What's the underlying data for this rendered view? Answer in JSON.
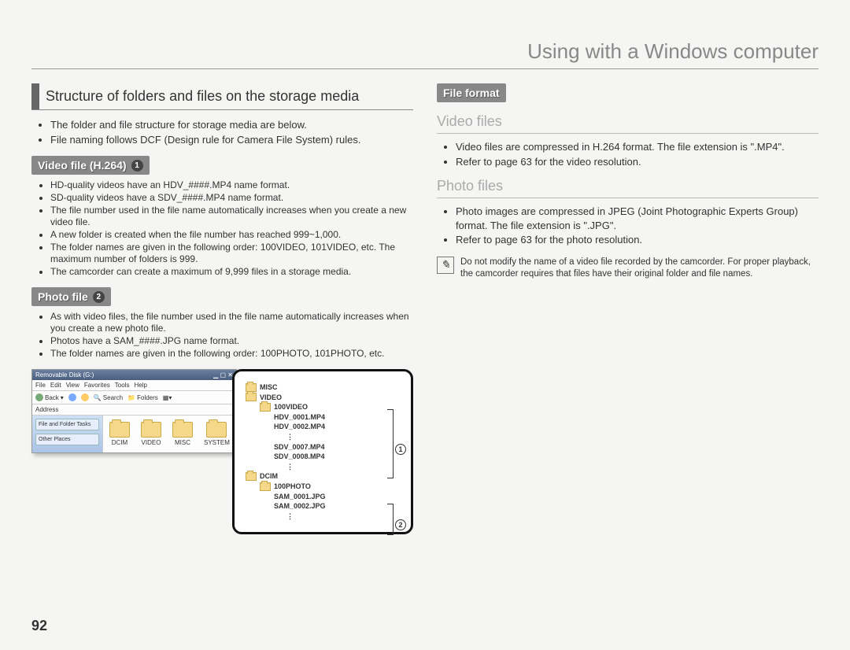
{
  "chapterTitle": "Using with a Windows computer",
  "pageNumber": "92",
  "left": {
    "heading": "Structure of folders and files on the storage media",
    "introBullets": [
      "The folder and file structure for storage media are below.",
      "File naming follows DCF (Design rule for Camera File System) rules."
    ],
    "videoLabel": "Video file (H.264)",
    "videoBadge": "1",
    "videoBullets": [
      "HD-quality videos have an HDV_####.MP4 name format.",
      "SD-quality videos have a SDV_####.MP4 name format.",
      "The file number used in the file name automatically increases when you create a new video file.",
      "A new folder is created when the file number has reached 999~1,000.",
      "The folder names are given in the following order: 100VIDEO, 101VIDEO, etc. The maximum number of folders is 999.",
      "The camcorder can create a maximum of 9,999 files in a storage media."
    ],
    "photoLabel": "Photo file",
    "photoBadge": "2",
    "photoBullets": [
      "As with video files, the file number used in the file name automatically increases when you create a new photo file.",
      "Photos have a SAM_####.JPG name format.",
      "The folder names are given in the following order: 100PHOTO, 101PHOTO, etc."
    ]
  },
  "right": {
    "fileFormatBox": "File format",
    "videoHeading": "Video files",
    "videoBullets": [
      "Video files are compressed in H.264 format. The file extension is \".MP4\".",
      "Refer to page 63 for the video resolution."
    ],
    "photoHeading": "Photo files",
    "photoBullets": [
      "Photo images are compressed in JPEG (Joint Photographic Experts Group) format. The file extension is \".JPG\".",
      "Refer to page 63 for the photo resolution."
    ],
    "noteText": "Do not modify the name of a video file recorded by the camcorder. For proper playback, the camcorder requires that files have their original folder and file names."
  },
  "explorer": {
    "title": "Removable Disk (G:)",
    "menus": [
      "File",
      "Edit",
      "View",
      "Favorites",
      "Tools",
      "Help"
    ],
    "back": "Back",
    "search": "Search",
    "foldersBtn": "Folders",
    "addressLabel": "Address",
    "sideTasks": "File and Folder Tasks",
    "sideOther": "Other Places",
    "folders": [
      "DCIM",
      "VIDEO",
      "MISC",
      "SYSTEM"
    ]
  },
  "tree": {
    "misc": "MISC",
    "video": "VIDEO",
    "v100": "100VIDEO",
    "hd1": "HDV_0001.MP4",
    "hd2": "HDV_0002.MP4",
    "sd1": "SDV_0007.MP4",
    "sd2": "SDV_0008.MP4",
    "dcim": "DCIM",
    "p100": "100PHOTO",
    "s1": "SAM_0001.JPG",
    "s2": "SAM_0002.JPG",
    "call1": "1",
    "call2": "2"
  }
}
